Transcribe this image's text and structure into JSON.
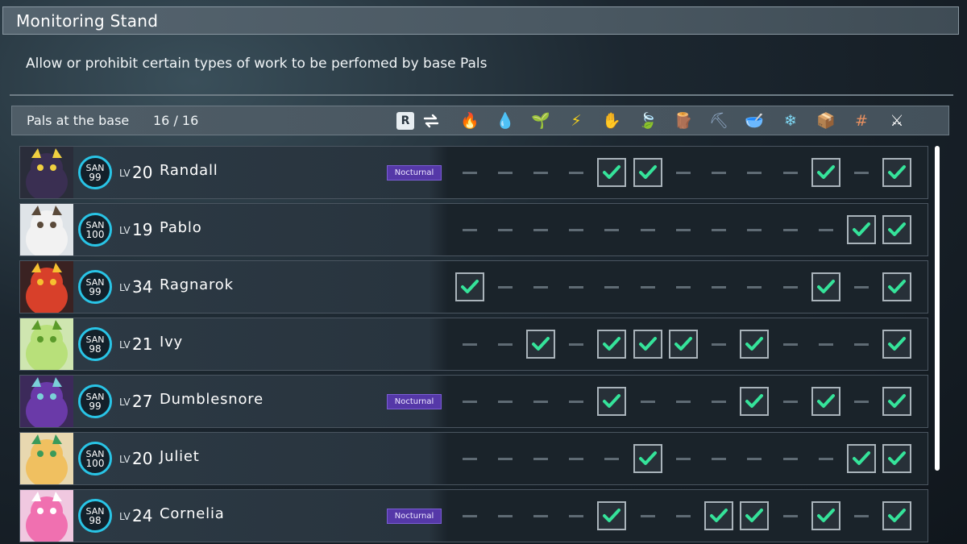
{
  "window": {
    "title": "Monitoring Stand",
    "subtitle": "Allow or prohibit certain types of work to be perfomed by base Pals"
  },
  "header": {
    "label": "Pals at the base",
    "count": "16 / 16",
    "sort_key": "R",
    "work_icons": [
      {
        "name": "kindling-icon",
        "glyph": "🔥",
        "color": "#e8502e"
      },
      {
        "name": "watering-icon",
        "glyph": "💧",
        "color": "#2fb6ea"
      },
      {
        "name": "planting-icon",
        "glyph": "🌱",
        "color": "#7bd23a"
      },
      {
        "name": "electricity-icon",
        "glyph": "⚡",
        "color": "#f6d21a"
      },
      {
        "name": "handiwork-icon",
        "glyph": "✋",
        "color": "#f2c27a"
      },
      {
        "name": "gathering-icon",
        "glyph": "🍃",
        "color": "#4fcf5a"
      },
      {
        "name": "lumbering-icon",
        "glyph": "🪵",
        "color": "#d8783a"
      },
      {
        "name": "mining-icon",
        "glyph": "⛏",
        "color": "#8ea7c4"
      },
      {
        "name": "medicine-icon",
        "glyph": "🥣",
        "color": "#9ed44a"
      },
      {
        "name": "cooling-icon",
        "glyph": "❄",
        "color": "#7fd8f4"
      },
      {
        "name": "transporting-icon",
        "glyph": "📦",
        "color": "#e0985a"
      },
      {
        "name": "farming-icon",
        "glyph": "#",
        "color": "#e89060"
      },
      {
        "name": "combat-icon",
        "glyph": "⚔",
        "color": "#ffffff"
      }
    ]
  },
  "colors": {
    "check": "#35e39a",
    "san_ring": "#29c4e6",
    "nocturnal_bg": "#5538a8"
  },
  "pals": [
    {
      "name": "Randall",
      "lv_tag": "LV",
      "level": "20",
      "san_label": "SAN",
      "san": "99",
      "nocturnal": "Nocturnal",
      "portrait": "dark-pal-portrait",
      "work": [
        0,
        0,
        0,
        0,
        1,
        1,
        0,
        0,
        0,
        0,
        1,
        0,
        1
      ]
    },
    {
      "name": "Pablo",
      "lv_tag": "LV",
      "level": "19",
      "san_label": "SAN",
      "san": "100",
      "nocturnal": null,
      "portrait": "white-pal-portrait",
      "work": [
        0,
        0,
        0,
        0,
        0,
        0,
        0,
        0,
        0,
        0,
        0,
        1,
        1
      ]
    },
    {
      "name": "Ragnarok",
      "lv_tag": "LV",
      "level": "34",
      "san_label": "SAN",
      "san": "99",
      "nocturnal": null,
      "portrait": "fire-pal-portrait",
      "work": [
        1,
        0,
        0,
        0,
        0,
        0,
        0,
        0,
        0,
        0,
        1,
        0,
        1
      ]
    },
    {
      "name": "Ivy",
      "lv_tag": "LV",
      "level": "21",
      "san_label": "SAN",
      "san": "98",
      "nocturnal": null,
      "portrait": "grass-pal-portrait",
      "work": [
        0,
        0,
        1,
        0,
        1,
        1,
        1,
        0,
        1,
        0,
        0,
        0,
        1
      ]
    },
    {
      "name": "Dumblesnore",
      "lv_tag": "LV",
      "level": "27",
      "san_label": "SAN",
      "san": "99",
      "nocturnal": "Nocturnal",
      "portrait": "witch-pal-portrait",
      "work": [
        0,
        0,
        0,
        0,
        1,
        0,
        0,
        0,
        1,
        0,
        1,
        0,
        1
      ]
    },
    {
      "name": "Juliet",
      "lv_tag": "LV",
      "level": "20",
      "san_label": "SAN",
      "san": "100",
      "nocturnal": null,
      "portrait": "fox-pal-portrait",
      "work": [
        0,
        0,
        0,
        0,
        0,
        1,
        0,
        0,
        0,
        0,
        0,
        1,
        1
      ]
    },
    {
      "name": "Cornelia",
      "lv_tag": "LV",
      "level": "24",
      "san_label": "SAN",
      "san": "98",
      "nocturnal": "Nocturnal",
      "portrait": "pink-pal-portrait",
      "work": [
        0,
        0,
        0,
        0,
        1,
        0,
        0,
        1,
        1,
        0,
        1,
        0,
        1
      ]
    }
  ]
}
